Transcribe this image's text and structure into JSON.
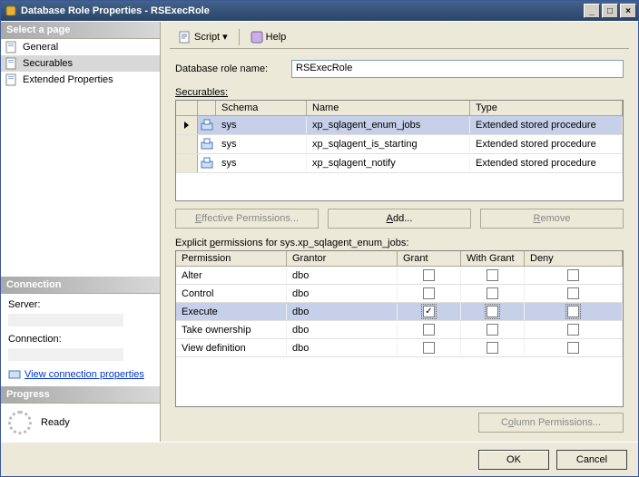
{
  "window": {
    "title": "Database Role Properties - RSExecRole"
  },
  "toolbar": {
    "script": "Script",
    "help": "Help"
  },
  "leftpane": {
    "select_page": "Select a page",
    "items": [
      {
        "label": "General"
      },
      {
        "label": "Securables"
      },
      {
        "label": "Extended Properties"
      }
    ],
    "connection_header": "Connection",
    "server_label": "Server:",
    "connection_label": "Connection:",
    "view_props": "View connection properties",
    "progress_header": "Progress",
    "ready": "Ready"
  },
  "main": {
    "role_name_label": "Database role name:",
    "role_name_value": "RSExecRole",
    "securables_label": "Securables:",
    "securables_headers": {
      "schema": "Schema",
      "name": "Name",
      "type": "Type"
    },
    "securables_rows": [
      {
        "schema": "sys",
        "name": "xp_sqlagent_enum_jobs",
        "type": "Extended stored procedure"
      },
      {
        "schema": "sys",
        "name": "xp_sqlagent_is_starting",
        "type": "Extended stored procedure"
      },
      {
        "schema": "sys",
        "name": "xp_sqlagent_notify",
        "type": "Extended stored procedure"
      }
    ],
    "effective_btn": "Effective Permissions...",
    "add_btn": "Add...",
    "remove_btn": "Remove",
    "explicit_label": "Explicit permissions for sys.xp_sqlagent_enum_jobs:",
    "perm_headers": {
      "permission": "Permission",
      "grantor": "Grantor",
      "grant": "Grant",
      "withgrant": "With Grant",
      "deny": "Deny"
    },
    "perm_rows": [
      {
        "permission": "Alter",
        "grantor": "dbo",
        "grant": false,
        "withgrant": false,
        "deny": false
      },
      {
        "permission": "Control",
        "grantor": "dbo",
        "grant": false,
        "withgrant": false,
        "deny": false
      },
      {
        "permission": "Execute",
        "grantor": "dbo",
        "grant": true,
        "withgrant": false,
        "deny": false
      },
      {
        "permission": "Take ownership",
        "grantor": "dbo",
        "grant": false,
        "withgrant": false,
        "deny": false
      },
      {
        "permission": "View definition",
        "grantor": "dbo",
        "grant": false,
        "withgrant": false,
        "deny": false
      }
    ],
    "column_perm_btn": "Column Permissions..."
  },
  "footer": {
    "ok": "OK",
    "cancel": "Cancel"
  }
}
